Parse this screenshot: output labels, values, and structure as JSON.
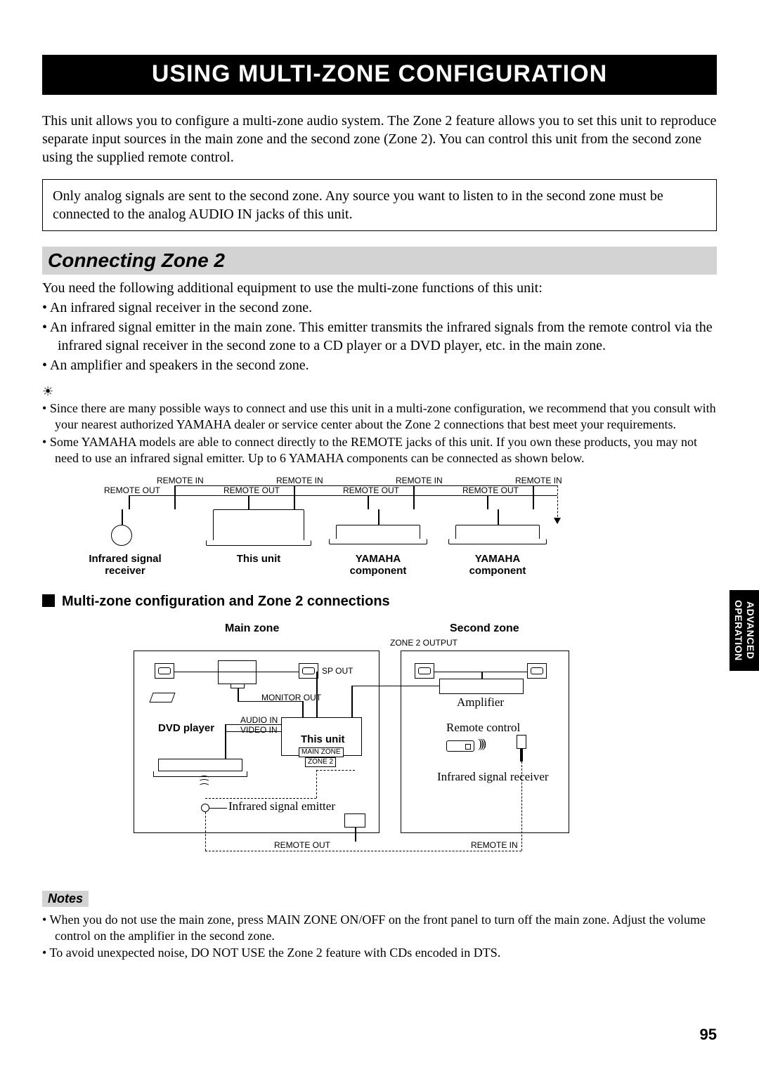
{
  "title": "USING MULTI-ZONE CONFIGURATION",
  "intro": "This unit allows you to configure a multi-zone audio system. The Zone 2 feature allows you to set this unit to reproduce separate input sources in the main zone and the second zone (Zone 2). You can control this unit from the second zone using the supplied remote control.",
  "note_box": "Only analog signals are sent to the second zone. Any source you want to listen to in the second zone must be connected to the analog AUDIO IN jacks of this unit.",
  "section_heading": "Connecting Zone 2",
  "equip_intro": "You need the following additional equipment to use the multi-zone functions of this unit:",
  "equip_bullets": [
    "An infrared signal receiver in the second zone.",
    "An infrared signal emitter in the main zone. This emitter transmits the infrared signals from the remote control via the infrared signal receiver in the second zone to a CD player or a DVD player, etc. in the main zone.",
    "An amplifier and speakers in the second zone."
  ],
  "tip_bullets": [
    "Since there are many possible ways to connect and use this unit in a multi-zone configuration, we recommend that you consult with your nearest authorized YAMAHA dealer or service center about the Zone 2 connections that best meet your requirements.",
    "Some YAMAHA models are able to connect directly to the REMOTE jacks of this unit. If you own these products, you may not need to use an infrared signal emitter. Up to 6 YAMAHA components can be connected as shown below."
  ],
  "diagram1": {
    "remote_in": "REMOTE IN",
    "remote_out": "REMOTE OUT",
    "cap1": "Infrared signal\nreceiver",
    "cap2": "This unit",
    "cap3": "YAMAHA\ncomponent",
    "cap4": "YAMAHA\ncomponent"
  },
  "subheading": "Multi-zone configuration and Zone 2 connections",
  "diagram2": {
    "main_zone": "Main zone",
    "second_zone": "Second zone",
    "zone2_output": "ZONE 2 OUTPUT",
    "sp_out": "SP OUT",
    "monitor_out": "MONITOR OUT",
    "audio_in": "AUDIO IN",
    "video_in": "VIDEO IN",
    "dvd_player": "DVD player",
    "this_unit": "This unit",
    "main_zone_box": "MAIN ZONE",
    "zone2_box": "ZONE 2",
    "amplifier": "Amplifier",
    "remote_control": "Remote control",
    "ir_receiver": "Infrared signal receiver",
    "ir_emitter": "Infrared signal emitter",
    "remote_out": "REMOTE OUT",
    "remote_in": "REMOTE IN"
  },
  "notes_label": "Notes",
  "notes_bullets": [
    "When you do not use the main zone, press MAIN ZONE ON/OFF on the front panel to turn off the main zone. Adjust the volume control on the amplifier in the second zone.",
    "To avoid unexpected noise, DO NOT USE the Zone 2 feature with CDs encoded in DTS."
  ],
  "side_tab_line1": "ADVANCED",
  "side_tab_line2": "OPERATION",
  "page_number": "95"
}
